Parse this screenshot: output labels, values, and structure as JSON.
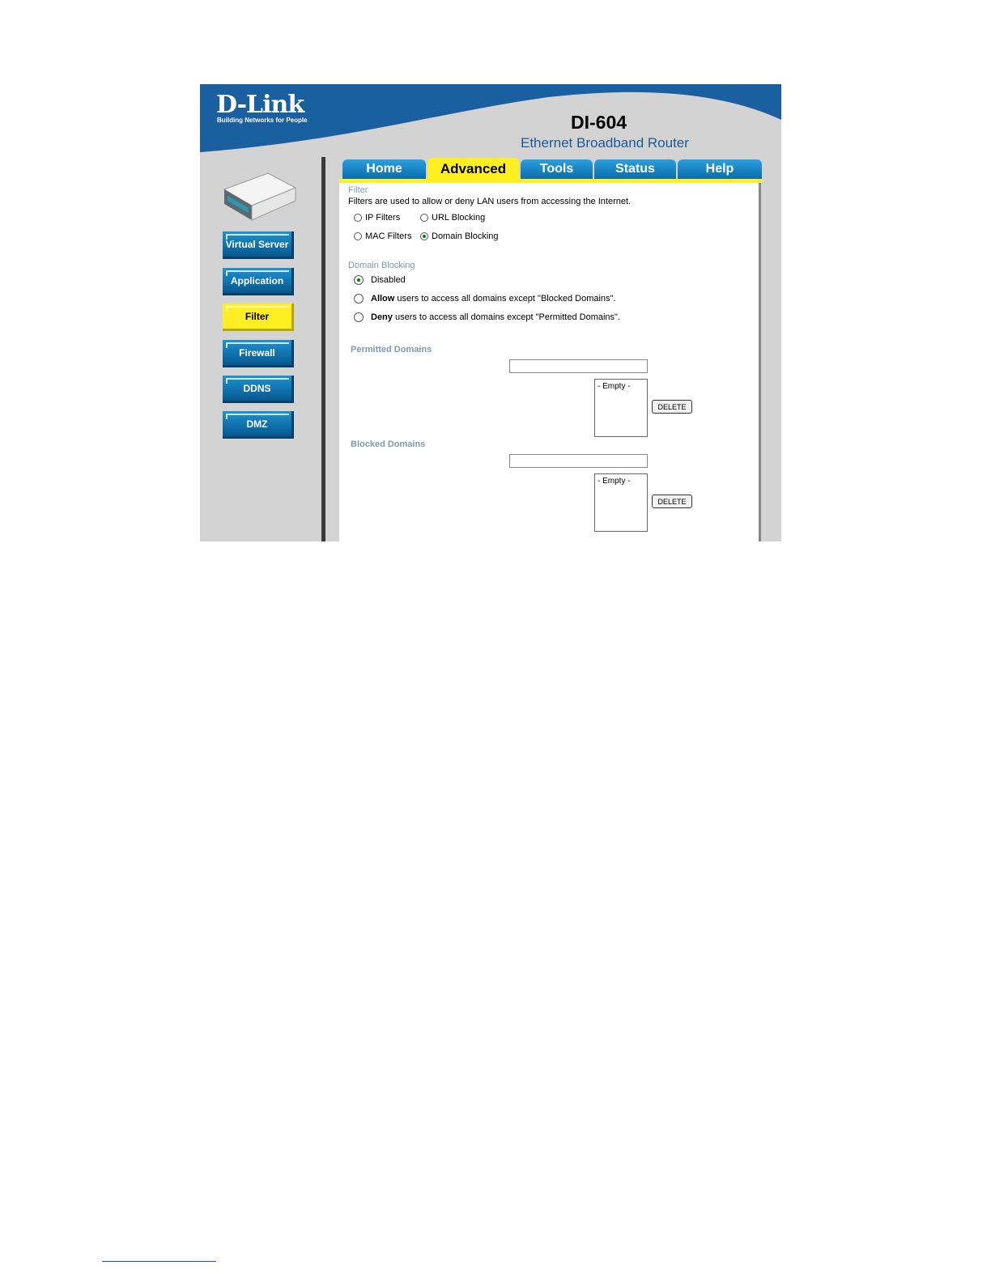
{
  "header": {
    "brand": "D-Link",
    "tagline": "Building Networks for People",
    "model": "DI-604",
    "product": "Ethernet Broadband Router"
  },
  "tabs": [
    {
      "label": "Home"
    },
    {
      "label": "Advanced",
      "active": true
    },
    {
      "label": "Tools"
    },
    {
      "label": "Status"
    },
    {
      "label": "Help"
    }
  ],
  "sidebar": [
    {
      "label": "Virtual Server"
    },
    {
      "label": "Application"
    },
    {
      "label": "Filter",
      "active": true
    },
    {
      "label": "Firewall"
    },
    {
      "label": "DDNS"
    },
    {
      "label": "DMZ"
    }
  ],
  "filter": {
    "title": "Filter",
    "description": "Filters are used to allow or deny LAN users from accessing the Internet.",
    "options": [
      "IP Filters",
      "URL Blocking",
      "MAC Filters",
      "Domain Blocking"
    ],
    "selected": "Domain Blocking"
  },
  "domain_blocking": {
    "title": "Domain Blocking",
    "disabled": "Disabled",
    "allow_bold": "Allow",
    "allow_rest": " users to access all domains except \"Blocked Domains\".",
    "deny_bold": "Deny",
    "deny_rest": " users to access all domains except \"Permitted Domains\".",
    "selected": "Disabled"
  },
  "permitted": {
    "title": "Permitted Domains",
    "input_value": "",
    "list_item": "- Empty -",
    "button": "DELETE"
  },
  "blocked": {
    "title": "Blocked Domains",
    "input_value": "",
    "list_item": "- Empty -",
    "button": "DELETE"
  },
  "colors": {
    "tab_blue": "#1782c5",
    "active_yellow": "#ffee22",
    "header_blue": "#1a5fa0",
    "panel_gray": "#d3d3d3"
  }
}
